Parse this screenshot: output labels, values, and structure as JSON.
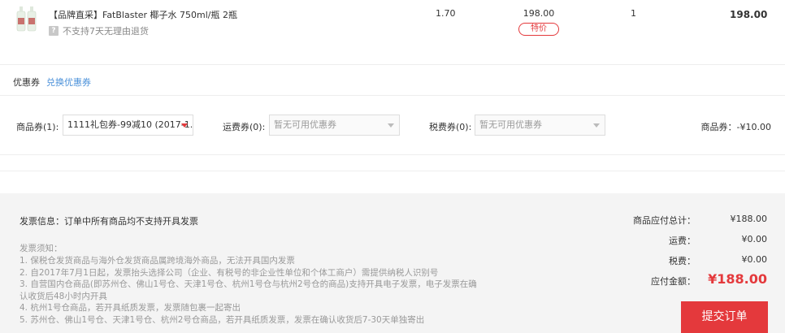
{
  "product": {
    "title": "【品牌直采】FatBlaster 椰子水 750ml/瓶 2瓶",
    "return_policy": "不支持7天无理由退货",
    "return_icon": "?",
    "weight": "1.70",
    "price": "198.00",
    "badge": "特价",
    "quantity": "1",
    "subtotal": "198.00"
  },
  "coupons": {
    "label": "优惠券",
    "exchange_link": "兑换优惠券",
    "goods_coupon_label": "商品券(1):",
    "goods_coupon_value": "1111礼包券-99减10 (2017-1...",
    "shipping_coupon_label": "运费券(0):",
    "shipping_coupon_value": "暂无可用优惠券",
    "tax_coupon_label": "税费券(0):",
    "tax_coupon_value": "暂无可用优惠券",
    "summary": "商品券：-¥10.00"
  },
  "invoice": {
    "info": "发票信息：订单中所有商品均不支持开具发票",
    "notes_title": "发票须知：",
    "notes": [
      "1. 保税仓发货商品与海外仓发货商品属跨境海外商品，无法开具国内发票",
      "2. 自2017年7月1日起，发票抬头选择公司（企业、有税号的非企业性单位和个体工商户）需提供纳税人识别号",
      "3. 自营国内仓商品(即苏州仓、佛山1号仓、天津1号仓、杭州1号仓与杭州2号仓的商品)支持开具电子发票，电子发票在确",
      "认收货后48小时内开具",
      "4. 杭州1号仓商品，若开具纸质发票，发票随包裹一起寄出",
      "5. 苏州仓、佛山1号仓、天津1号仓、杭州2号仓商品，若开具纸质发票，发票在确认收货后7-30天单独寄出"
    ]
  },
  "summary": {
    "goods_total_label": "商品应付总计：",
    "goods_total_value": "¥188.00",
    "shipping_label": "运费：",
    "shipping_value": "¥0.00",
    "tax_label": "税费：",
    "tax_value": "¥0.00",
    "payable_label": "应付金额：",
    "payable_value": "¥188.00",
    "submit_label": "提交订单"
  },
  "colors": {
    "accent": "#e4393c",
    "link": "#4a90d9",
    "footer_bg": "#f4f4f4"
  }
}
